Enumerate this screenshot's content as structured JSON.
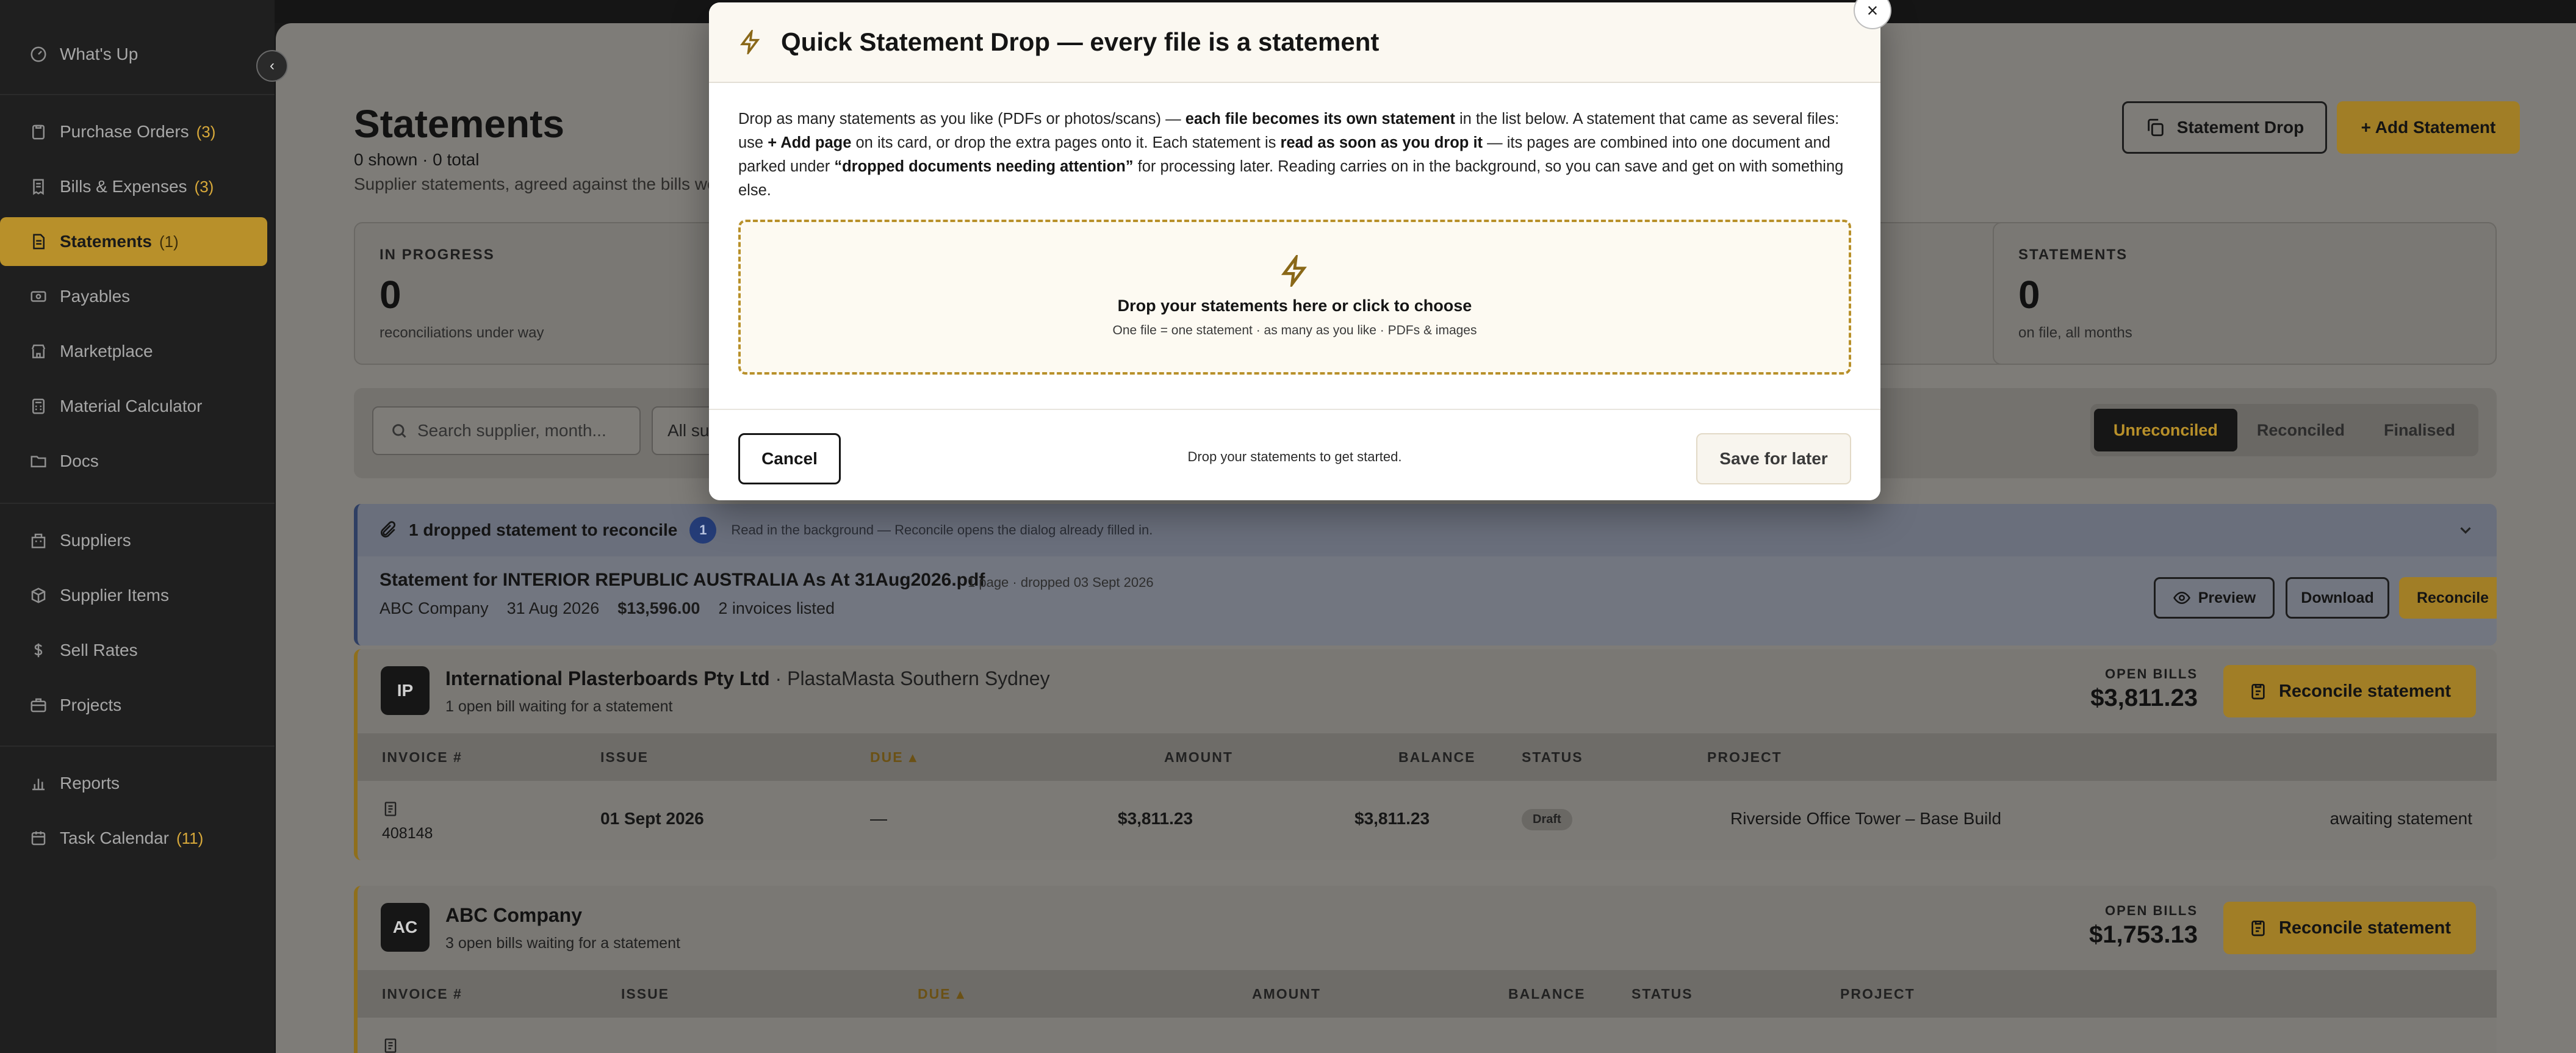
{
  "sidebar": {
    "items": [
      {
        "label": "What's Up",
        "count": "",
        "icon": "gauge-icon"
      },
      {
        "label": "Purchase Orders",
        "count": "(3)",
        "icon": "clipboard-icon"
      },
      {
        "label": "Bills & Expenses",
        "count": "(3)",
        "icon": "receipt-icon"
      },
      {
        "label": "Statements",
        "count": "(1)",
        "icon": "document-icon"
      },
      {
        "label": "Payables",
        "count": "",
        "icon": "banknote-icon"
      },
      {
        "label": "Marketplace",
        "count": "",
        "icon": "store-icon"
      },
      {
        "label": "Material Calculator",
        "count": "",
        "icon": "calculator-icon"
      },
      {
        "label": "Docs",
        "count": "",
        "icon": "folder-icon"
      },
      {
        "label": "Suppliers",
        "count": "",
        "icon": "building-icon"
      },
      {
        "label": "Supplier Items",
        "count": "",
        "icon": "box-icon"
      },
      {
        "label": "Sell Rates",
        "count": "",
        "icon": "dollar-icon"
      },
      {
        "label": "Projects",
        "count": "",
        "icon": "briefcase-icon"
      },
      {
        "label": "Reports",
        "count": "",
        "icon": "bar-chart-icon"
      },
      {
        "label": "Task Calendar",
        "count": "(11)",
        "icon": "calendar-icon"
      }
    ],
    "active": "Statements"
  },
  "page": {
    "title": "Statements",
    "count": "0 shown · 0 total",
    "subtitle": "Supplier statements, agreed against the bills we",
    "statement_drop_label": "Statement Drop",
    "add_statement_label": "+ Add Statement"
  },
  "stats": [
    {
      "label": "IN PROGRESS",
      "value": "0",
      "hint": "reconciliations under way"
    },
    {
      "label": "STATEMENTS",
      "value": "0",
      "hint": "on file, all months"
    }
  ],
  "filters": {
    "search_placeholder": "Search supplier, month...",
    "select_value": "All suppliers",
    "segments": [
      "Unreconciled",
      "Reconciled",
      "Finalised"
    ],
    "active_segment": "Unreconciled"
  },
  "dropped": {
    "title": "1 dropped statement to reconcile",
    "badge": "1",
    "note": "Read in the background — Reconcile opens the dialog already filled in.",
    "file_name": "Statement for INTERIOR REPUBLIC AUSTRALIA As At 31Aug2026.pdf",
    "file_meta": "1 page · dropped 03 Sept 2026",
    "supplier": "ABC Company",
    "date": "31 Aug 2026",
    "amount": "$13,596.00",
    "invoices": "2 invoices listed",
    "preview_label": "Preview",
    "download_label": "Download",
    "reconcile_label": "Reconcile"
  },
  "suppliers": [
    {
      "initials": "IP",
      "name": "International Plasterboards Pty Ltd",
      "branch": " · PlastaMasta Southern Sydney",
      "sub": "1 open bill waiting for a statement",
      "open_label": "OPEN BILLS",
      "open_amount": "$3,811.23",
      "reconcile_label": "Reconcile statement",
      "columns": [
        "INVOICE #",
        "ISSUE",
        "DUE",
        "AMOUNT",
        "BALANCE",
        "STATUS",
        "PROJECT"
      ],
      "rows": [
        {
          "invoice": "408148",
          "issue": "01 Sept 2026",
          "due": "—",
          "amount": "$3,811.23",
          "balance": "$3,811.23",
          "status": "Draft",
          "project": "Riverside Office Tower – Base Build",
          "note": "awaiting statement"
        }
      ]
    },
    {
      "initials": "AC",
      "name": "ABC Company",
      "branch": "",
      "sub": "3 open bills waiting for a statement",
      "open_label": "OPEN BILLS",
      "open_amount": "$1,753.13",
      "reconcile_label": "Reconcile statement",
      "columns": [
        "INVOICE #",
        "ISSUE",
        "DUE",
        "AMOUNT",
        "BALANCE",
        "STATUS",
        "PROJECT"
      ]
    }
  ],
  "modal": {
    "title": "Quick Statement Drop — every file is a statement",
    "body_1": "Drop as many statements as you like (PDFs or photos/scans) — ",
    "body_b1": "each file becomes its own statement",
    "body_2": " in the list below. A statement that came as several files: use ",
    "body_b2": "+ Add page",
    "body_3": " on its card, or drop the extra pages onto it. Each statement is ",
    "body_b3": "read as soon as you drop it",
    "body_4": " — its pages are combined into one document and parked under ",
    "body_b4": "“dropped documents needing attention”",
    "body_5": " for processing later. Reading carries on in the background, so you can save and get on with something else.",
    "drop_title": "Drop your statements here or click to choose",
    "drop_sub": "One file = one statement · as many as you like · PDFs & images",
    "cancel_label": "Cancel",
    "footer_hint": "Drop your statements to get started.",
    "save_label": "Save for later",
    "close_label": "×"
  },
  "colors": {
    "accent_gold": "#b8902a",
    "sidebar_bg": "#1f1f1f",
    "badge_blue": "#253d78"
  }
}
